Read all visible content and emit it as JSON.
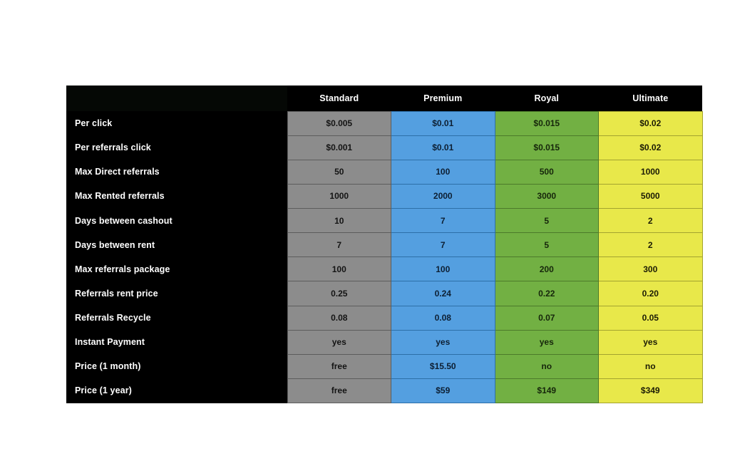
{
  "table": {
    "colors": {
      "background": "#ffffff",
      "label_column_bg": "#000000",
      "label_text": "#ffffff",
      "standard": "#8c8c8c",
      "premium": "#549fe0",
      "royal": "#72b043",
      "ultimate": "#e8e84a"
    },
    "corner_header": "",
    "columns": [
      {
        "key": "standard",
        "label": "Standard"
      },
      {
        "key": "premium",
        "label": "Premium"
      },
      {
        "key": "royal",
        "label": "Royal"
      },
      {
        "key": "ultimate",
        "label": "Ultimate"
      }
    ],
    "rows": [
      {
        "label": "Per click",
        "values": [
          "$0.005",
          "$0.01",
          "$0.015",
          "$0.02"
        ]
      },
      {
        "label": "Per referrals click",
        "values": [
          "$0.001",
          "$0.01",
          "$0.015",
          "$0.02"
        ]
      },
      {
        "label": "Max Direct referrals",
        "values": [
          "50",
          "100",
          "500",
          "1000"
        ]
      },
      {
        "label": "Max Rented referrals",
        "values": [
          "1000",
          "2000",
          "3000",
          "5000"
        ]
      },
      {
        "label": "Days between cashout",
        "values": [
          "10",
          "7",
          "5",
          "2"
        ]
      },
      {
        "label": "Days between rent",
        "values": [
          "7",
          "7",
          "5",
          "2"
        ]
      },
      {
        "label": "Max referrals package",
        "values": [
          "100",
          "100",
          "200",
          "300"
        ]
      },
      {
        "label": "Referrals rent price",
        "values": [
          "0.25",
          "0.24",
          "0.22",
          "0.20"
        ]
      },
      {
        "label": "Referrals Recycle",
        "values": [
          "0.08",
          "0.08",
          "0.07",
          "0.05"
        ]
      },
      {
        "label": "Instant Payment",
        "values": [
          "yes",
          "yes",
          "yes",
          "yes"
        ]
      },
      {
        "label": "Price (1 month)",
        "values": [
          "free",
          "$15.50",
          "no",
          "no"
        ]
      },
      {
        "label": "Price (1 year)",
        "values": [
          "free",
          "$59",
          "$149",
          "$349"
        ]
      }
    ]
  }
}
